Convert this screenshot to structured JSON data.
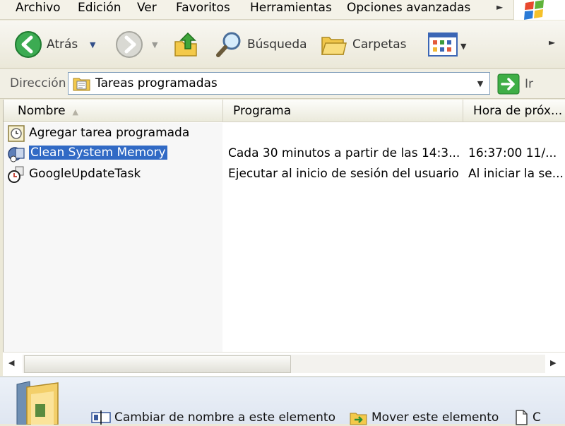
{
  "menu": {
    "items": [
      "Archivo",
      "Edición",
      "Ver",
      "Favoritos",
      "Herramientas",
      "Opciones avanzadas"
    ]
  },
  "toolbar": {
    "back_label": "Atrás",
    "search_label": "Búsqueda",
    "folders_label": "Carpetas"
  },
  "address": {
    "label": "Dirección",
    "value": "Tareas programadas",
    "go_label": "Ir"
  },
  "columns": {
    "name": "Nombre",
    "program": "Programa",
    "next_run": "Hora de próx..."
  },
  "rows": [
    {
      "name": "Agregar tarea programada",
      "program": "",
      "next_run": "",
      "icon": "add-task-icon"
    },
    {
      "name": "Clean System Memory",
      "program": "Cada 30 minutos a partir de las 14:3...",
      "next_run": "16:37:00  11/...",
      "icon": "scheduled-task-icon",
      "selected": true
    },
    {
      "name": "GoogleUpdateTask",
      "program": "Ejecutar al inicio de sesión del usuario",
      "next_run": "Al iniciar la se...",
      "icon": "clock-task-icon"
    }
  ],
  "tasks": {
    "rename": "Cambiar de nombre a este elemento",
    "move": "Mover este elemento",
    "copy_partial": "C"
  },
  "colors": {
    "selection": "#316ac5",
    "back_green": "#2ea04a"
  }
}
